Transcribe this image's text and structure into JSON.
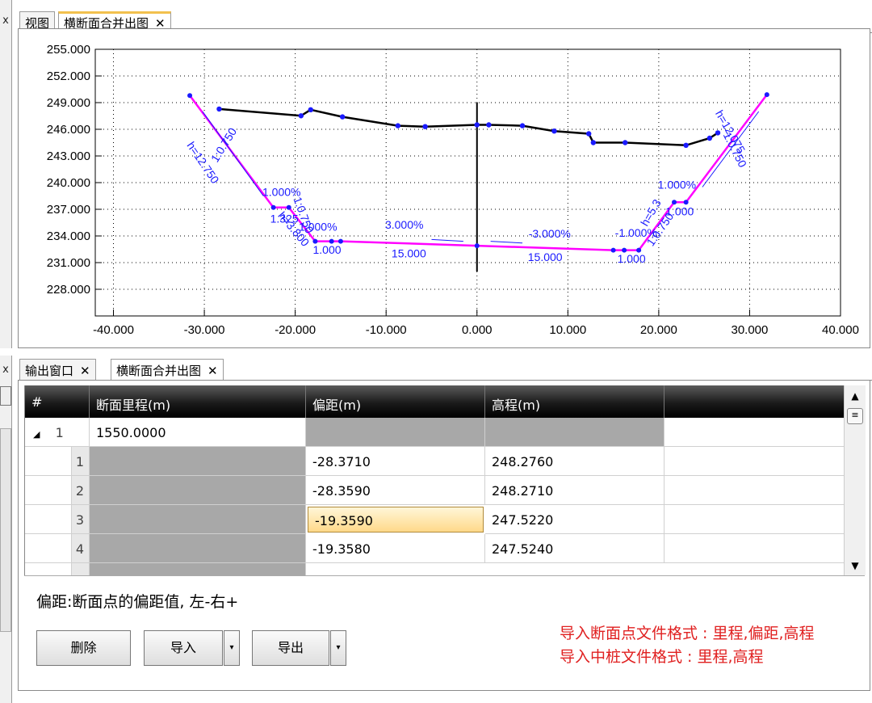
{
  "top_tabs": [
    {
      "label": "视图",
      "active": false
    },
    {
      "label": "横断面合并出图",
      "active": true,
      "close": "✕"
    }
  ],
  "bottom_tabs": [
    {
      "label": "输出窗口",
      "active": false,
      "close": "✕"
    },
    {
      "label": "横断面合并出图",
      "active": true,
      "close": "✕"
    }
  ],
  "chart_data": {
    "type": "line",
    "x_ticks": [
      "-40.000",
      "-30.000",
      "-20.000",
      "-10.000",
      "0.000",
      "10.000",
      "20.000",
      "30.000",
      "40.000"
    ],
    "y_ticks": [
      "255.000",
      "252.000",
      "249.000",
      "246.000",
      "243.000",
      "240.000",
      "237.000",
      "234.000",
      "231.000",
      "228.000"
    ],
    "xlim": [
      -42,
      40
    ],
    "ylim": [
      225,
      255
    ],
    "grid": true,
    "ground": {
      "color": "#000000",
      "points": [
        [
          -28.37,
          248.28
        ],
        [
          -19.36,
          247.52
        ],
        [
          -18.3,
          248.2
        ],
        [
          -14.8,
          247.4
        ],
        [
          -8.7,
          246.4
        ],
        [
          -5.7,
          246.3
        ],
        [
          0,
          246.5
        ],
        [
          1.3,
          246.5
        ],
        [
          5,
          246.4
        ],
        [
          8.5,
          245.8
        ],
        [
          12.3,
          245.5
        ],
        [
          12.8,
          244.5
        ],
        [
          16.3,
          244.5
        ],
        [
          23,
          244.2
        ],
        [
          25.6,
          245.0
        ],
        [
          26.5,
          245.6
        ]
      ]
    },
    "design": {
      "color": "#ff00ff",
      "points": [
        [
          -31.6,
          249.8
        ],
        [
          -22.4,
          237.2
        ],
        [
          -20.7,
          237.2
        ],
        [
          -17.8,
          233.4
        ],
        [
          -16.0,
          233.4
        ],
        [
          -15.0,
          233.4
        ],
        [
          0,
          232.9
        ],
        [
          15.0,
          232.4
        ],
        [
          16.2,
          232.4
        ],
        [
          17.8,
          232.4
        ],
        [
          21.7,
          237.8
        ],
        [
          23.0,
          237.8
        ],
        [
          31.9,
          249.9
        ]
      ]
    },
    "centerline": {
      "x": 0,
      "y": [
        230,
        249
      ]
    },
    "annotations": [
      "1:0.750",
      "h=12.750",
      "1.000%",
      "1.325",
      "1:0.750",
      "h=3.800",
      "1.000%",
      "1.000",
      "3.000%",
      "15.000",
      "-3.000%",
      "15.000",
      "-1.000%",
      "1.000",
      "1.000%",
      "1.000",
      "h=5.3",
      "1:0.750",
      "h=12.075",
      "1:0.750"
    ]
  },
  "grid": {
    "columns": [
      "#",
      "断面里程(m)",
      "偏距(m)",
      "高程(m)"
    ],
    "group": {
      "index": "1",
      "expander": "◢",
      "station": "1550.0000"
    },
    "rows": [
      {
        "index": "1",
        "offset": "-28.3710",
        "elev": "248.2760"
      },
      {
        "index": "2",
        "offset": "-28.3590",
        "elev": "248.2710"
      },
      {
        "index": "3",
        "offset": "-19.3590",
        "elev": "247.5220"
      },
      {
        "index": "4",
        "offset": "-19.3580",
        "elev": "247.5240"
      }
    ]
  },
  "description": "偏距:断面点的偏距值, 左-右+",
  "buttons": {
    "delete": "删除",
    "import": "导入",
    "export": "导出"
  },
  "hints": [
    "导入断面点文件格式 : 里程,偏距,高程",
    "导入中桩文件格式 : 里程,高程"
  ],
  "colors": {
    "accent_tab": "#f2c14e",
    "hint_text": "#e02020",
    "design_line": "#ff00ff",
    "annotation": "#1a1aff"
  }
}
